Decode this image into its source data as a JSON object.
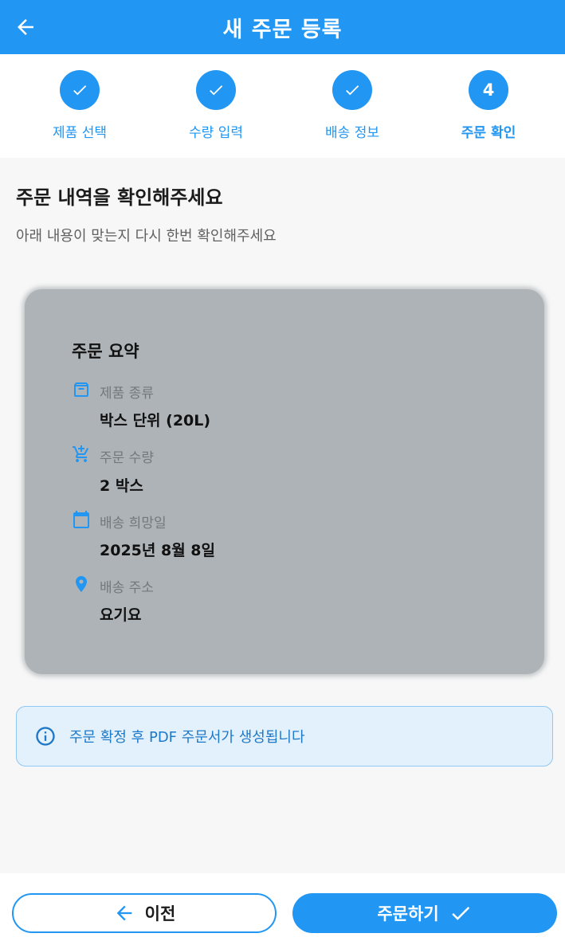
{
  "appbar": {
    "title": "새 주문 등록",
    "back_icon": "arrow-left-icon",
    "color": "#2196f3"
  },
  "stepper": {
    "steps": [
      {
        "label": "제품 선택",
        "state": "done",
        "icon": "check-icon"
      },
      {
        "label": "수량 입력",
        "state": "done",
        "icon": "check-icon"
      },
      {
        "label": "배송 정보",
        "state": "done",
        "icon": "check-icon"
      },
      {
        "label": "주문 확인",
        "state": "active",
        "number": "4"
      }
    ]
  },
  "main": {
    "heading": "주문 내역을 확인해주세요",
    "subheading": "아래 내용이 맞는지 다시 한번 확인해주세요"
  },
  "summary": {
    "title": "주문 요약",
    "rows": [
      {
        "icon": "archive-box-icon",
        "label": "제품 종류",
        "value": "박스 단위 (20L)"
      },
      {
        "icon": "add-to-cart-icon",
        "label": "주문 수량",
        "value": "2 박스"
      },
      {
        "icon": "calendar-icon",
        "label": "배송 희망일",
        "value": "2025년 8월 8일"
      },
      {
        "icon": "location-pin-icon",
        "label": "배송 주소",
        "value": "요기요"
      }
    ]
  },
  "info": {
    "icon": "info-icon",
    "text": "주문 확정 후 PDF 주문서가 생성됩니다"
  },
  "bottom": {
    "prev_label": "이전",
    "prev_icon": "arrow-left-icon",
    "submit_label": "주문하기",
    "submit_icon": "check-icon"
  }
}
